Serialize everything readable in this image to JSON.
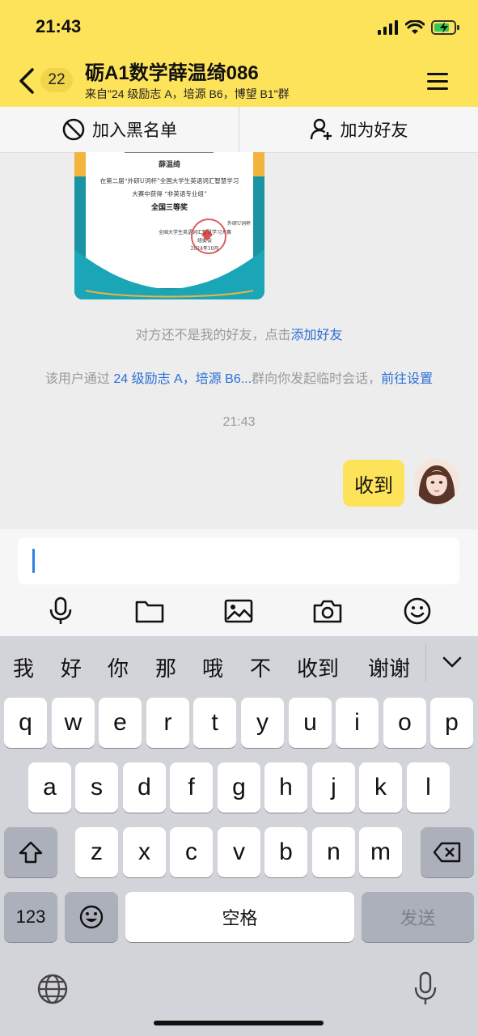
{
  "status": {
    "time": "21:43"
  },
  "header": {
    "unread_count": "22",
    "title": "砺A1数学薛温绮086",
    "subtitle": "来自\"24 级励志 A，培源 B6，博望 B1\"群"
  },
  "actions": {
    "block_label": "加入黑名单",
    "add_friend_label": "加为好友"
  },
  "certificate": {
    "name": "薛温绮",
    "line1": "在第二届“外研U词杯”全国大学生英语词汇智慧学习",
    "line2": "大赛中获得 “非英语专业组”",
    "award": "全国三等奖",
    "issuer": "全国大学生英语词汇智慧学习大赛",
    "seal_text": "外研U词杯",
    "org": "组委会",
    "date": "2024年10月"
  },
  "messages": {
    "not_friend_text": "对方还不是我的好友，点击",
    "add_friend_link": "添加好友",
    "temp_chat_prefix": "该用户通过",
    "temp_chat_group_link": "24 级励志 A，培源 B6...",
    "temp_chat_suffix": "群向你发起临时会话，",
    "settings_link": "前往设置",
    "timestamp": "21:43",
    "my_message": "收到"
  },
  "candidates": [
    "我",
    "好",
    "你",
    "那",
    "哦",
    "不",
    "收到",
    "谢谢"
  ],
  "keyboard": {
    "row1": [
      "q",
      "w",
      "e",
      "r",
      "t",
      "y",
      "u",
      "i",
      "o",
      "p"
    ],
    "row2": [
      "a",
      "s",
      "d",
      "f",
      "g",
      "h",
      "j",
      "k",
      "l"
    ],
    "row3": [
      "z",
      "x",
      "c",
      "v",
      "b",
      "n",
      "m"
    ],
    "numbers_key": "123",
    "space_key": "空格",
    "send_key": "发送"
  },
  "colors": {
    "accent_yellow": "#fde35a",
    "link_blue": "#2b6fd6"
  }
}
